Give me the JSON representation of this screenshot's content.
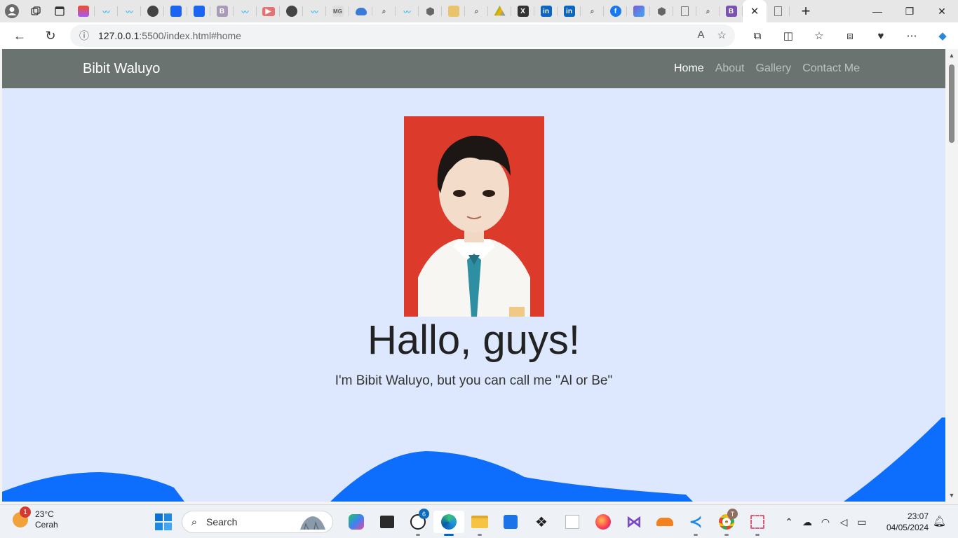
{
  "browser": {
    "active_tab_close_glyph": "✕",
    "new_tab_glyph": "+",
    "url_host": "127.0.0.1",
    "url_path": ":5500/index.html#home",
    "favicon_letters": [
      "B",
      "MG",
      "X",
      "in",
      "in",
      "f",
      "B"
    ]
  },
  "site": {
    "brand": "Bibit Waluyo",
    "nav": [
      "Home",
      "About",
      "Gallery",
      "Contact Me"
    ],
    "active_nav": "Home",
    "hero_title": "Hallo, guys!",
    "hero_subtitle": "I'm Bibit Waluyo, but you can call me \"Al or Be\"",
    "colors": {
      "navbar": "#6b7370",
      "page_bg": "#dde8fe",
      "wave": "#0d6efd",
      "photo_bg": "#dc3a2b"
    }
  },
  "taskbar": {
    "weather_temp": "23°C",
    "weather_desc": "Cerah",
    "weather_badge": "1",
    "search_label": "Search",
    "whatsapp_badge": "6",
    "chrome_badge": "T",
    "time": "23:07",
    "date": "04/05/2024"
  }
}
